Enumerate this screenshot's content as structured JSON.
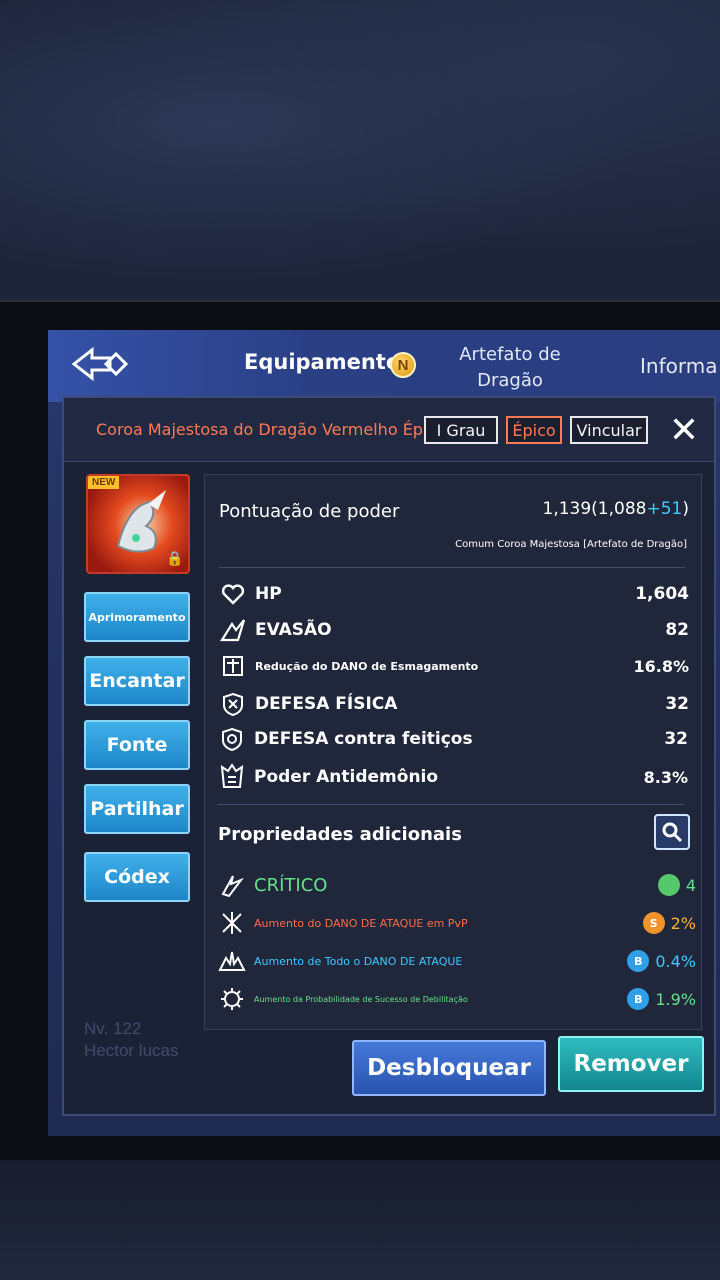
{
  "nav": {
    "active_tab": "Equipamento",
    "active_badge": "N",
    "tab2": "Artefato de Dragão",
    "tab3": "Informa"
  },
  "item": {
    "title": "Coroa Majestosa do Dragão Vermelho Épica",
    "grade_button": "I  Grau",
    "epic_button": "Épico",
    "bind_button": "Vincular",
    "close": "✕"
  },
  "side_buttons": [
    "Aprimoramento",
    "Encantar",
    "Fonte",
    "Partilhar",
    "Códex"
  ],
  "power": {
    "label": "Pontuação de poder",
    "value_main": "1,139(1,088",
    "value_bonus": "+51",
    "value_end": ")",
    "subtitle": "Comum Coroa Majestosa [Artefato de Dragão]"
  },
  "stats": [
    {
      "icon": "heart-icon",
      "label": "HP",
      "value": "1,604"
    },
    {
      "icon": "evasion-icon",
      "label": "EVASÃO",
      "value": "82"
    },
    {
      "icon": "crush-reduction-icon",
      "label": "Redução do DANO de Esmagamento",
      "value": "16.8%"
    },
    {
      "icon": "physical-defense-icon",
      "label": "DEFESA FÍSICA",
      "value": "32"
    },
    {
      "icon": "spell-defense-icon",
      "label": "DEFESA contra feitiços",
      "value": "32"
    },
    {
      "icon": "anti-demon-icon",
      "label": "Poder Antidemônio",
      "value": "8.3%"
    }
  ],
  "additional": {
    "title": "Propriedades adicionais",
    "rows": [
      {
        "icon": "critical-icon",
        "label": "CRÍTICO",
        "dot": "",
        "dot_color": "#56c76a",
        "value": "4",
        "label_color": "#66e08a",
        "value_color": "#66e08a"
      },
      {
        "icon": "pvp-attack-icon",
        "label": "Aumento do DANO DE ATAQUE em PvP",
        "dot": "S",
        "dot_color": "#f0932a",
        "value": "2%",
        "label_color": "#ff6a4a",
        "value_color": "#ffb13a"
      },
      {
        "icon": "all-attack-icon",
        "label": "Aumento de Todo o DANO DE ATAQUE",
        "dot": "B",
        "dot_color": "#2f9fe8",
        "value": "0.4%",
        "label_color": "#3ec8ff",
        "value_color": "#3ec8ff"
      },
      {
        "icon": "debuff-success-icon",
        "label": "Aumento da Probabilidade de Sucesso de Debilitação",
        "dot": "B",
        "dot_color": "#2f9fe8",
        "value": "1.9%",
        "label_color": "#66e08a",
        "value_color": "#66e08a"
      }
    ]
  },
  "actions": {
    "unlock": "Desbloquear",
    "remove": "Remover"
  },
  "ghost": {
    "line1": "Nv. 122",
    "line2": "Hector lucas"
  }
}
